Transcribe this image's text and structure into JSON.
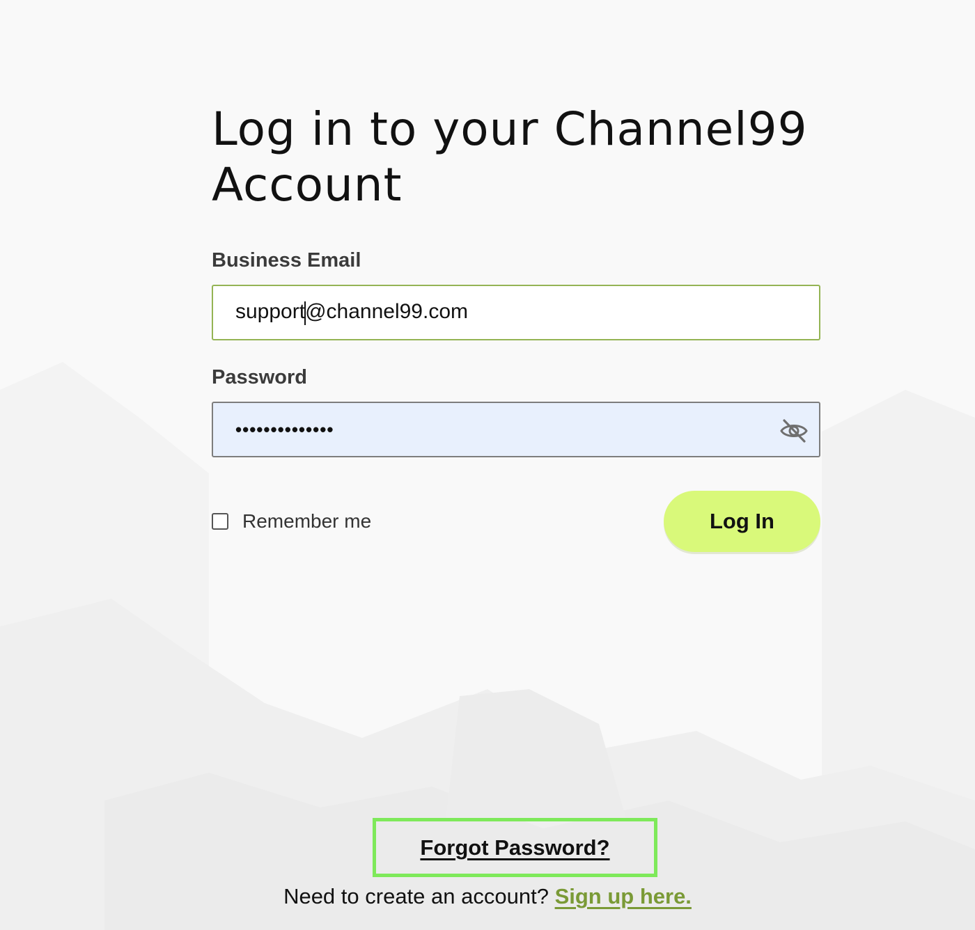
{
  "login": {
    "title": "Log in to your Channel99 Account",
    "email_label": "Business Email",
    "email_value": "support@channel99.com",
    "password_label": "Password",
    "password_value": "••••••••••••••",
    "remember_label": "Remember me",
    "login_button": "Log In"
  },
  "footer": {
    "forgot_password": "Forgot Password?",
    "signup_prompt": "Need to create an account?",
    "signup_link": "Sign up here."
  },
  "icons": {
    "password_toggle": "eye-slash-icon"
  },
  "colors": {
    "accent": "#d9f97a",
    "link_green": "#7a9a36",
    "focus_border": "#94b454",
    "highlight_box": "#7ee95a",
    "autofill_bg": "#e8f0fd"
  }
}
